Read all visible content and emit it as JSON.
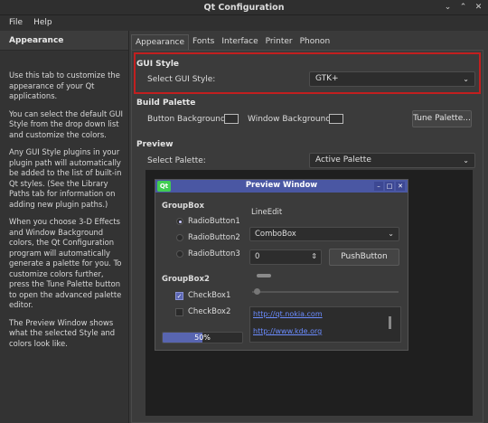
{
  "window": {
    "title": "Qt Configuration",
    "wm_buttons": [
      "⌄",
      "⌃",
      "✕"
    ]
  },
  "menu": [
    "File",
    "Help"
  ],
  "left_panel": {
    "header": "Appearance",
    "paragraphs": [
      "Use this tab to customize the appearance of your Qt applications.",
      "You can select the default GUI Style from the drop down list and customize the colors.",
      "Any GUI Style plugins in your plugin path will automatically be added to the list of built-in Qt styles. (See the Library Paths tab for information on adding new plugin paths.)",
      "When you choose 3-D Effects and Window Background colors, the Qt Configuration program will automatically generate a palette for you. To customize colors further, press the Tune Palette button to open the advanced palette editor.",
      "The Preview Window shows what the selected Style and colors look like."
    ]
  },
  "tabs": [
    "Appearance",
    "Fonts",
    "Interface",
    "Printer",
    "Phonon"
  ],
  "gui_style": {
    "section": "GUI Style",
    "label": "Select GUI Style:",
    "value": "GTK+"
  },
  "build_palette": {
    "section": "Build Palette",
    "button_bg_label": "Button Background:",
    "window_bg_label": "Window Background:",
    "tune_button": "Tune Palette..."
  },
  "preview": {
    "section": "Preview",
    "label": "Select Palette:",
    "value": "Active Palette"
  },
  "preview_window": {
    "title": "Preview Window",
    "icon_text": "Qt",
    "groupbox1": "GroupBox",
    "radios": [
      "RadioButton1",
      "RadioButton2",
      "RadioButton3"
    ],
    "groupbox2": "GroupBox2",
    "checks": [
      "CheckBox1",
      "CheckBox2"
    ],
    "lineedit": "LineEdit",
    "combobox": "ComboBox",
    "spin_value": "0",
    "push_button": "PushButton",
    "links": [
      "http://qt.nokia.com",
      "http://www.kde.org"
    ],
    "progress_text": "50%",
    "progress_value": 0.5
  }
}
